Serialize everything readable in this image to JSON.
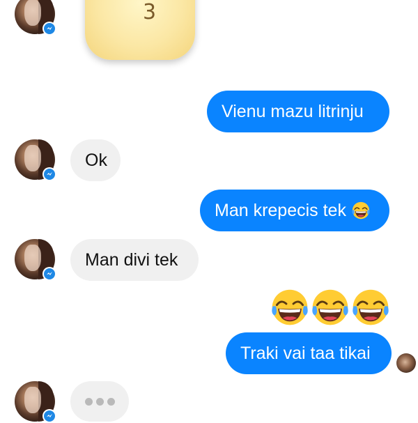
{
  "conversation": {
    "messages": [
      {
        "id": "msg1",
        "direction": "outgoing",
        "text": "Vienu mazu litrinju"
      },
      {
        "id": "msg2",
        "direction": "incoming",
        "text": "Ok"
      },
      {
        "id": "msg3",
        "direction": "outgoing",
        "text": "Man krepecis tek"
      },
      {
        "id": "msg4",
        "direction": "incoming",
        "text": "Man divi tek"
      },
      {
        "id": "msg5",
        "direction": "outgoing",
        "text": "Traki vai taa tikai"
      }
    ],
    "msg3_emoji": "face-with-tears-of-joy",
    "emoji_row": [
      "face-with-tears-of-joy",
      "face-with-tears-of-joy",
      "face-with-tears-of-joy"
    ],
    "typing_indicator": true
  },
  "icons": {
    "avatar_badge": "messenger-icon",
    "sticker": "sticker-image"
  },
  "colors": {
    "outgoing_bubble": "#0a84ff",
    "incoming_bubble": "#f0f0f0",
    "messenger_badge": "#1e88e5",
    "background": "#ffffff"
  }
}
